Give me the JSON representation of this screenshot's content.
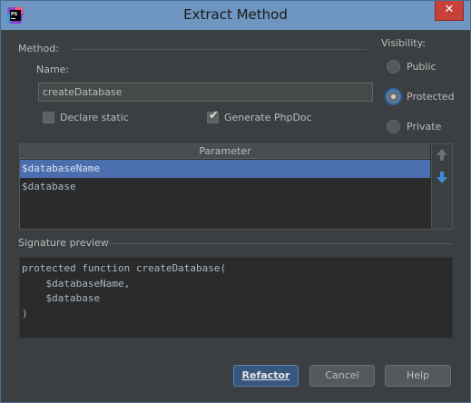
{
  "window": {
    "title": "Extract Method",
    "close_glyph": "✕",
    "app_icon": "phpstorm-icon"
  },
  "method": {
    "group_label": "Method:",
    "name_label": "Name:",
    "name_value": "createDatabase",
    "declare_static_label": "Declare static",
    "declare_static_checked": false,
    "generate_phpdoc_label": "Generate PhpDoc",
    "generate_phpdoc_checked": true
  },
  "visibility": {
    "label": "Visibility:",
    "options": [
      {
        "label": "Public",
        "selected": false
      },
      {
        "label": "Protected",
        "selected": true
      },
      {
        "label": "Private",
        "selected": false
      }
    ]
  },
  "parameters": {
    "header": "Parameter",
    "rows": [
      "$databaseName",
      "$database"
    ],
    "selected_index": 0,
    "move_up_icon": "arrow-up-icon",
    "move_down_icon": "arrow-down-icon"
  },
  "signature": {
    "label": "Signature preview",
    "lines": [
      "protected function createDatabase(",
      "    $databaseName,",
      "    $database",
      ")"
    ]
  },
  "buttons": {
    "refactor": "Refactor",
    "cancel": "Cancel",
    "help": "Help"
  },
  "colors": {
    "background": "#3c3f41",
    "selection": "#4b6eaf",
    "titlebar": "#6f96c0",
    "close": "#c7413a"
  }
}
